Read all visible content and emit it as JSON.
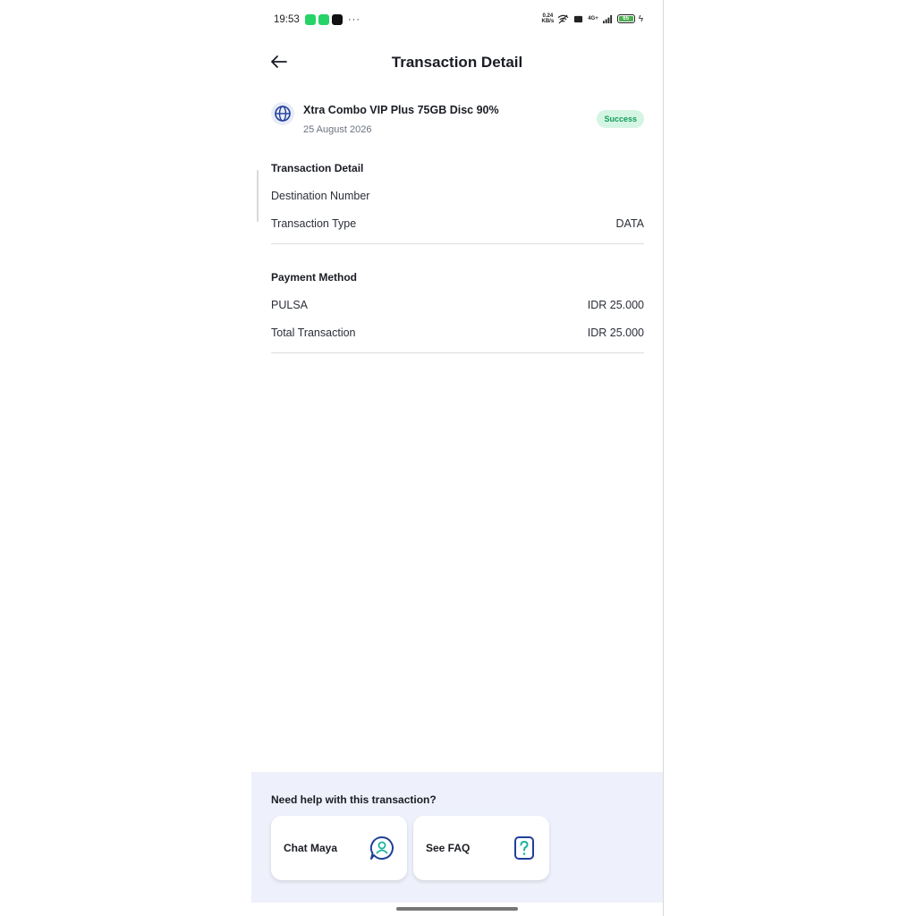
{
  "status_bar": {
    "time": "19:53",
    "more": "···",
    "net_speed_value": "0.24",
    "net_speed_unit": "KB/s",
    "network": "4G+",
    "battery": "65"
  },
  "header": {
    "title": "Transaction Detail"
  },
  "product": {
    "name": "Xtra Combo VIP Plus 75GB Disc 90%",
    "date": "25 August 2026",
    "status": "Success"
  },
  "transaction_detail": {
    "heading": "Transaction Detail",
    "rows": [
      {
        "label": "Destination Number",
        "value": ""
      },
      {
        "label": "Transaction Type",
        "value": "DATA"
      }
    ]
  },
  "payment": {
    "heading": "Payment Method",
    "rows": [
      {
        "label": "PULSA",
        "value": "IDR 25.000"
      },
      {
        "label": "Total Transaction",
        "value": "IDR 25.000"
      }
    ]
  },
  "help": {
    "question": "Need help with this transaction?",
    "chat_label": "Chat Maya",
    "faq_label": "See FAQ"
  },
  "colors": {
    "accent": "#1f3f9a",
    "teal": "#1bb3a2",
    "success_bg": "#d5f5e4",
    "success_text": "#0f9d58",
    "help_bg": "#eef1fb"
  },
  "icons": [
    "back-arrow-icon",
    "globe-icon",
    "chat-support-icon",
    "faq-question-icon"
  ]
}
